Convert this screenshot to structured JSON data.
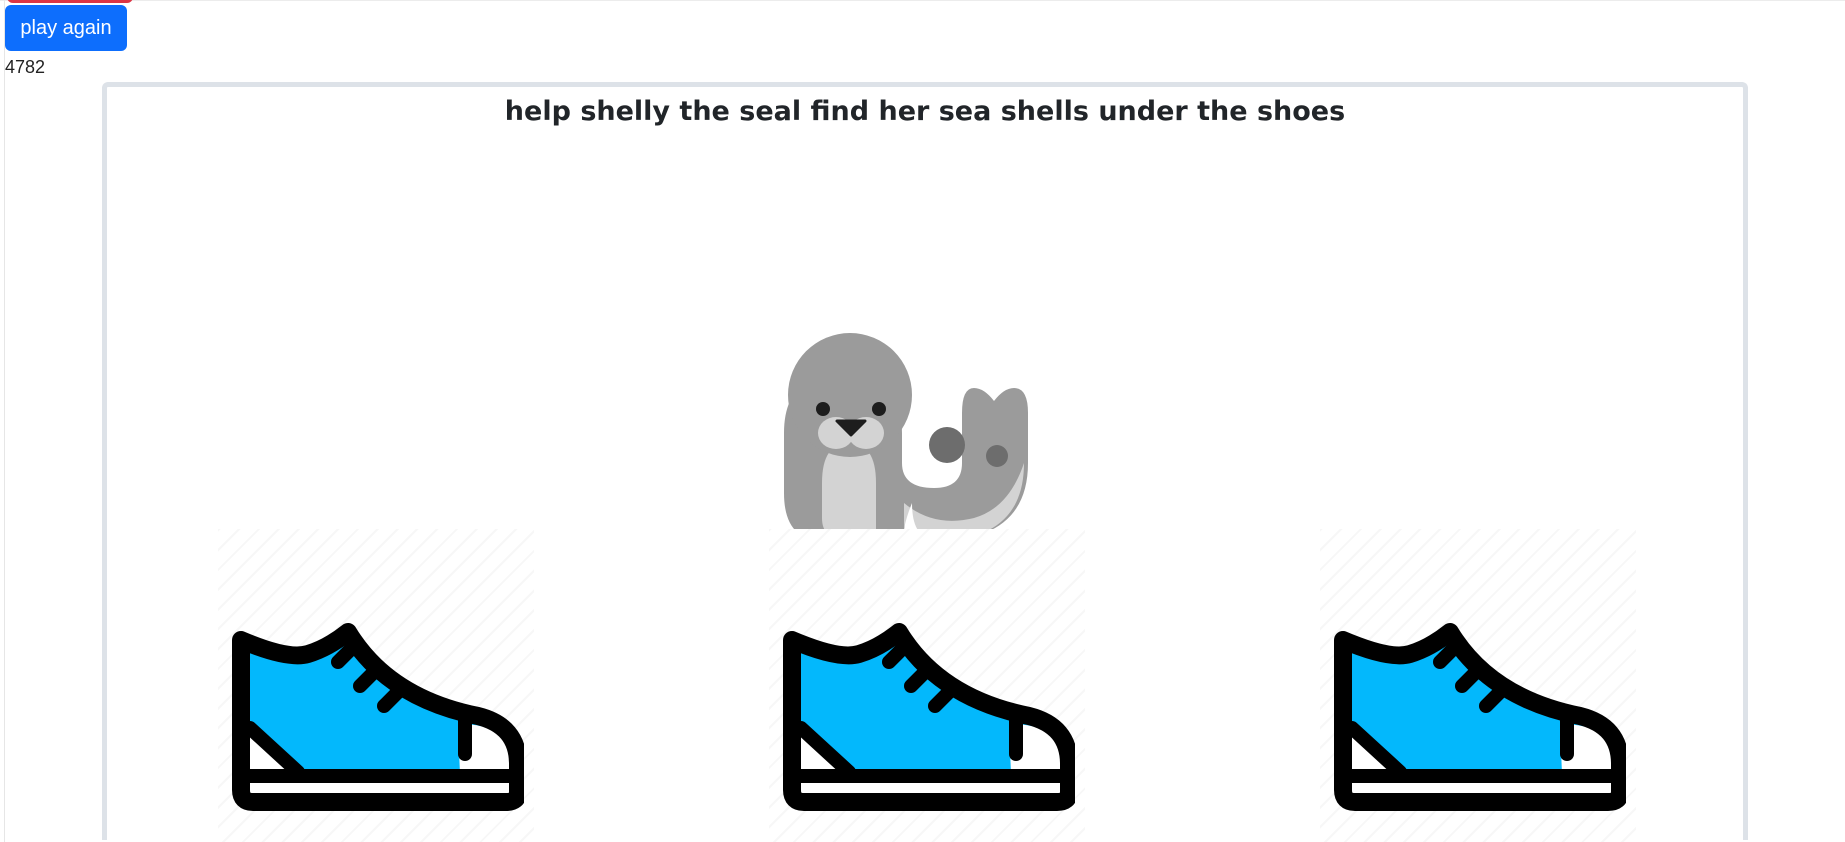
{
  "controls": {
    "play_again_label": "play again",
    "score": "4782"
  },
  "game": {
    "title": "help shelly the seal find her sea shells under the shoes",
    "character_icon": "seal-icon",
    "cups": [
      {
        "icon": "sneaker-icon",
        "color": "#03b8fc"
      },
      {
        "icon": "sneaker-icon",
        "color": "#03b8fc"
      },
      {
        "icon": "sneaker-icon",
        "color": "#03b8fc"
      }
    ]
  },
  "colors": {
    "button": "#0d6efd",
    "accent_tab": "#dc3545",
    "board_border": "#dde2e8",
    "shoe_fill": "#03b8fc"
  }
}
